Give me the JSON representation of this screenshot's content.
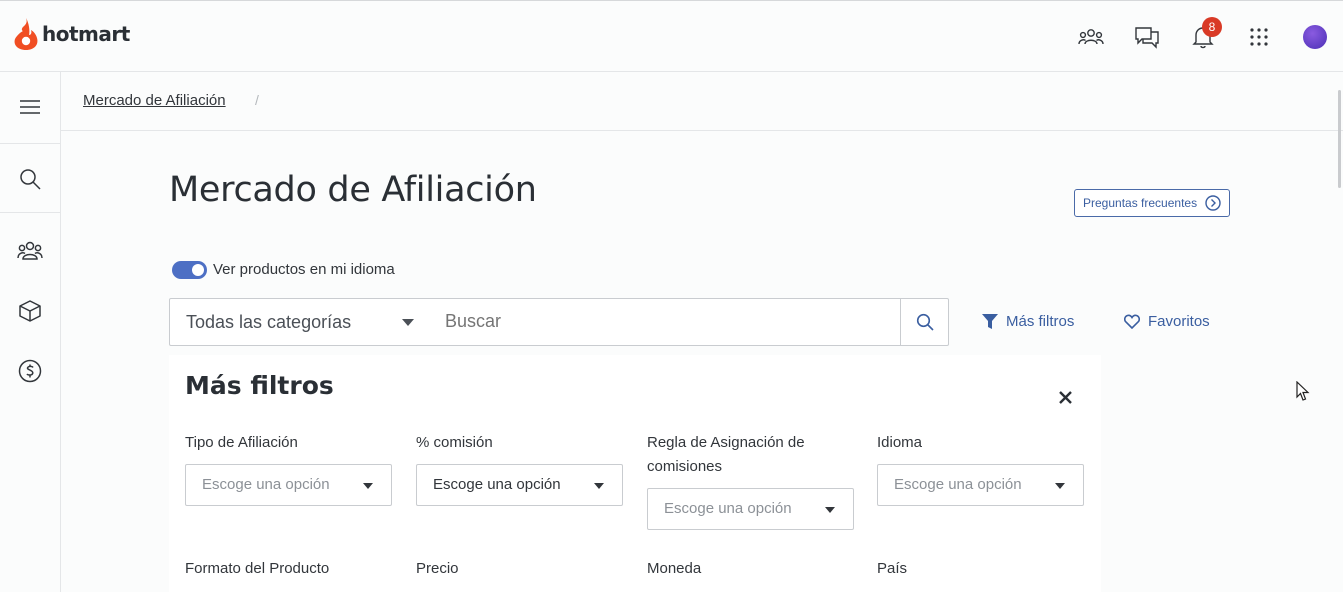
{
  "brand": {
    "name": "hotmart",
    "color": "#f04e23"
  },
  "header": {
    "icons": [
      "users-icon",
      "chat-icon",
      "bell-icon",
      "apps-grid-icon"
    ],
    "notification_count": "8"
  },
  "sidebar": {
    "items": [
      "menu-icon",
      "search-icon",
      "users-icon",
      "box-icon",
      "dollar-icon"
    ]
  },
  "breadcrumb": {
    "item": "Mercado de Afiliación",
    "separator": "/"
  },
  "page": {
    "title": "Mercado de Afiliación",
    "faq_label": "Preguntas frecuentes",
    "toggle_label": "Ver productos en mi idioma",
    "toggle_on": true
  },
  "search": {
    "category_value": "Todas las categorías",
    "placeholder": "Buscar",
    "more_filters_label": "Más filtros",
    "favorites_label": "Favoritos"
  },
  "filters": {
    "title": "Más filtros",
    "fields": [
      {
        "label": "Tipo de Afiliación",
        "value": "Escoge una opción"
      },
      {
        "label": "% comisión",
        "value": "Escoge una opción"
      },
      {
        "label": "Regla de Asignación de comisiones",
        "value": "Escoge una opción"
      },
      {
        "label": "Idioma",
        "value": "Escoge una opción"
      }
    ],
    "fields_row2": [
      {
        "label": "Formato del Producto"
      },
      {
        "label": "Precio"
      },
      {
        "label": "Moneda"
      },
      {
        "label": "País"
      }
    ]
  },
  "colors": {
    "accent": "#3a5ea0",
    "toggle": "#4d6fc4",
    "badge": "#d93a26"
  }
}
